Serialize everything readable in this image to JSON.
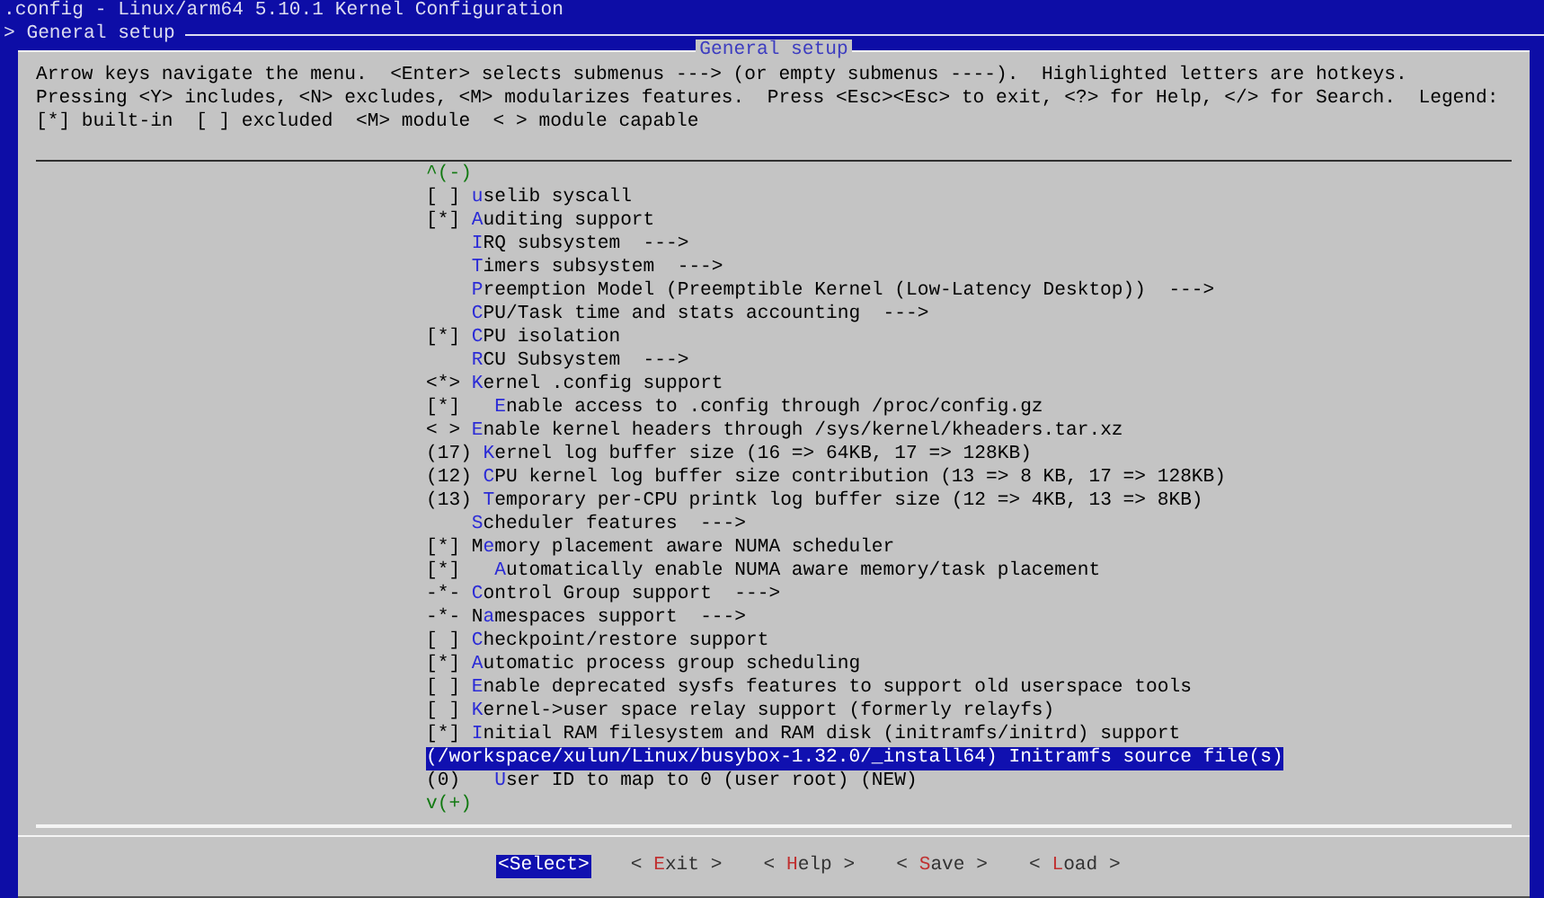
{
  "window": {
    "title": ".config - Linux/arm64 5.10.1 Kernel Configuration"
  },
  "breadcrumb": "> General setup",
  "dialog": {
    "title": "General setup",
    "help_text": "Arrow keys navigate the menu.  <Enter> selects submenus ---> (or empty submenus ----).  Highlighted letters are hotkeys.  Pressing <Y> includes, <N> excludes, <M> modularizes features.  Press <Esc><Esc> to exit, <?> for Help, </> for Search.  Legend: [*] built-in  [ ] excluded  <M> module  < > module capable"
  },
  "menu": {
    "scroll_up": "^(-)",
    "scroll_down": "v(+)",
    "items": [
      {
        "prefix": "[ ]",
        "hotkey": "u",
        "after": "selib syscall",
        "selected": false
      },
      {
        "prefix": "[*]",
        "hotkey": "A",
        "after": "uditing support",
        "selected": false
      },
      {
        "hotkey": "I",
        "after": "RQ subsystem  --->",
        "selected": false
      },
      {
        "hotkey": "T",
        "after": "imers subsystem  --->",
        "selected": false
      },
      {
        "hotkey": "P",
        "after": "reemption Model (Preemptible Kernel (Low-Latency Desktop))  --->",
        "selected": false
      },
      {
        "hotkey": "C",
        "after": "PU/Task time and stats accounting  --->",
        "selected": false
      },
      {
        "prefix": "[*]",
        "hotkey": "C",
        "after": "PU isolation",
        "selected": false
      },
      {
        "hotkey": "R",
        "after": "CU Subsystem  --->",
        "selected": false
      },
      {
        "prefix": "<*>",
        "hotkey": "K",
        "after": "ernel .config support",
        "selected": false,
        "children": [
          {
            "prefix": "[*]",
            "hotkey": "E",
            "after": "nable access to .config through /proc/config.gz",
            "selected": false
          }
        ]
      },
      {
        "prefix": "< >",
        "hotkey": "E",
        "after": "nable kernel headers through /sys/kernel/kheaders.tar.xz",
        "selected": false
      },
      {
        "prefix": "(17)",
        "hotkey": "K",
        "after": "ernel log buffer size (16 => 64KB, 17 => 128KB)",
        "selected": false
      },
      {
        "prefix": "(12)",
        "hotkey": "C",
        "after": "PU kernel log buffer size contribution (13 => 8 KB, 17 => 128KB)",
        "selected": false
      },
      {
        "prefix": "(13)",
        "hotkey": "T",
        "after": "emporary per-CPU printk log buffer size (12 => 4KB, 13 => 8KB)",
        "selected": false
      },
      {
        "hotkey": "S",
        "after": "cheduler features  --->",
        "selected": false
      },
      {
        "prefix": "[*]",
        "before": "M",
        "hotkey": "e",
        "after": "mory placement aware NUMA scheduler",
        "selected": false,
        "children": [
          {
            "prefix": "[*]",
            "hotkey": "A",
            "after": "utomatically enable NUMA aware memory/task placement",
            "selected": false
          }
        ]
      },
      {
        "prefix": "-*-",
        "hotkey": "C",
        "after": "ontrol Group support  --->",
        "selected": false
      },
      {
        "prefix": "-*-",
        "before": "N",
        "hotkey": "a",
        "after": "mespaces support  --->",
        "selected": false
      },
      {
        "prefix": "[ ]",
        "hotkey": "C",
        "after": "heckpoint/restore support",
        "selected": false
      },
      {
        "prefix": "[*]",
        "hotkey": "A",
        "after": "utomatic process group scheduling",
        "selected": false
      },
      {
        "prefix": "[ ]",
        "hotkey": "E",
        "after": "nable deprecated sysfs features to support old userspace tools",
        "selected": false
      },
      {
        "prefix": "[ ]",
        "hotkey": "K",
        "after": "ernel->user space relay support (formerly relayfs)",
        "selected": false
      },
      {
        "prefix": "[*]",
        "hotkey": "I",
        "after": "nitial RAM filesystem and RAM disk (initramfs/initrd) support",
        "selected": false
      },
      {
        "prefix": "(/workspace/xulun/Linux/busybox-1.32.0/_install64)",
        "hotkey": "I",
        "after": "nitramfs source file(s)",
        "selected": true,
        "children": [
          {
            "prefix": "(0)",
            "hotkey": "U",
            "after": "ser ID to map to 0 (user root) (NEW)",
            "selected": false
          }
        ]
      }
    ]
  },
  "buttons": [
    {
      "before": "<",
      "hotkey": "S",
      "after": "elect>",
      "selected": true
    },
    {
      "before": "< ",
      "hotkey": "E",
      "after": "xit >",
      "selected": false
    },
    {
      "before": "< ",
      "hotkey": "H",
      "after": "elp >",
      "selected": false
    },
    {
      "before": "< ",
      "hotkey": "S",
      "after": "ave >",
      "selected": false
    },
    {
      "before": "< ",
      "hotkey": "L",
      "after": "oad >",
      "selected": false
    }
  ]
}
